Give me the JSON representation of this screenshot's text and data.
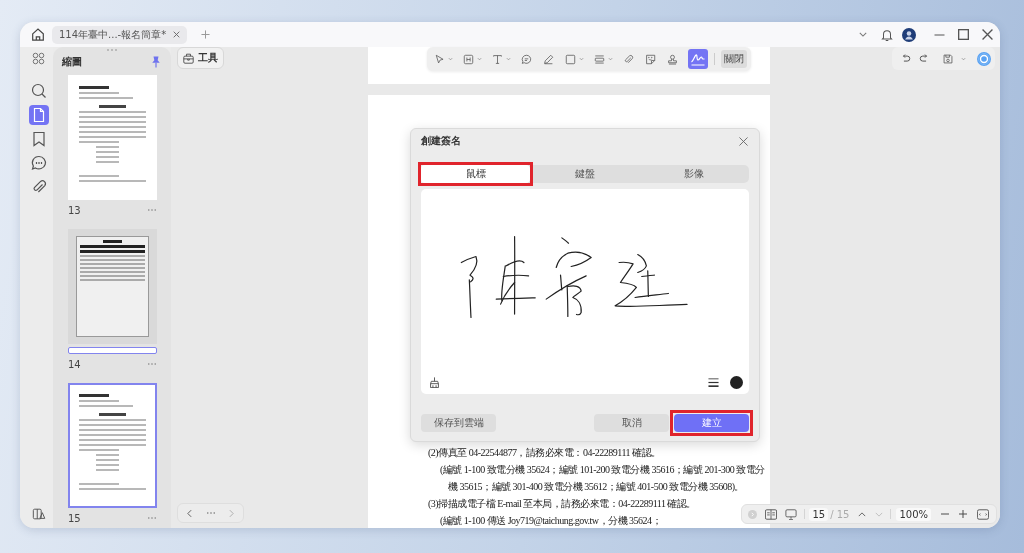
{
  "titlebar": {
    "tabs": [
      {
        "title": "114年臺中...-報名簡章*",
        "selected": true
      }
    ]
  },
  "rail": {
    "items": [
      {
        "kind": "search",
        "selected": false
      },
      {
        "kind": "pages",
        "selected": true
      },
      {
        "kind": "bookmark",
        "selected": false
      },
      {
        "kind": "comment",
        "selected": false
      },
      {
        "kind": "attachment",
        "selected": false
      }
    ]
  },
  "thumbnails": {
    "title": "縮圖",
    "pages": [
      {
        "number": "13",
        "kind": "form",
        "selected": false,
        "marker": false
      },
      {
        "number": "14",
        "kind": "scan",
        "selected": false,
        "marker": true
      },
      {
        "number": "15",
        "kind": "form",
        "selected": true,
        "marker": false
      }
    ]
  },
  "tools_button": {
    "label": "工具"
  },
  "toolbar": {
    "items": [
      {
        "kind": "select",
        "dropdown": true,
        "selected": false
      },
      {
        "kind": "form",
        "dropdown": true,
        "selected": false
      },
      {
        "kind": "text",
        "dropdown": true,
        "selected": false
      },
      {
        "kind": "comment",
        "dropdown": false,
        "selected": false
      },
      {
        "kind": "pen",
        "dropdown": false,
        "selected": false
      },
      {
        "kind": "shape",
        "dropdown": true,
        "selected": false
      },
      {
        "kind": "stripe",
        "dropdown": true,
        "selected": false
      },
      {
        "kind": "attachment",
        "dropdown": false,
        "selected": false
      },
      {
        "kind": "sticker",
        "dropdown": false,
        "selected": false
      },
      {
        "kind": "stamp",
        "dropdown": false,
        "selected": false
      },
      {
        "kind": "signature",
        "dropdown": false,
        "selected": true
      }
    ],
    "close_label": "關閉"
  },
  "dialog": {
    "title": "創建簽名",
    "tabs": [
      {
        "label": "鼠標",
        "selected": true,
        "highlighted": true
      },
      {
        "label": "鍵盤",
        "selected": false,
        "highlighted": false
      },
      {
        "label": "影像",
        "selected": false,
        "highlighted": false
      }
    ],
    "buttons": [
      {
        "kind": "save_cloud",
        "label": "保存到雲端",
        "highlighted": false
      },
      {
        "kind": "cancel",
        "label": "取消",
        "highlighted": false
      },
      {
        "kind": "create",
        "label": "建立",
        "highlighted": true
      }
    ]
  },
  "document": {
    "lines": [
      {
        "kind": "item",
        "text": "(2)傳真至 04-22544877，請務必來電：04-22289111 確認。"
      },
      {
        "kind": "note",
        "text": "(編號 1-100 致電分機 35624；編號 101-200 致電分機 35616；編號 201-300 致電分"
      },
      {
        "kind": "wrap",
        "text": "機 35615；編號 301-400 致電分機 35612；編號 401-500 致電分機 35608)。"
      },
      {
        "kind": "item",
        "text": "(3)掃描成電子檔 E-mail 至本局，請務必來電：04-22289111 確認。"
      },
      {
        "kind": "note",
        "text": "(編號 1-100 傳送 Joy719@taichung.gov.tw，分機 35624；"
      }
    ]
  },
  "page_nav": {
    "current": "15",
    "total": "/ 15",
    "zoom": "100%"
  }
}
